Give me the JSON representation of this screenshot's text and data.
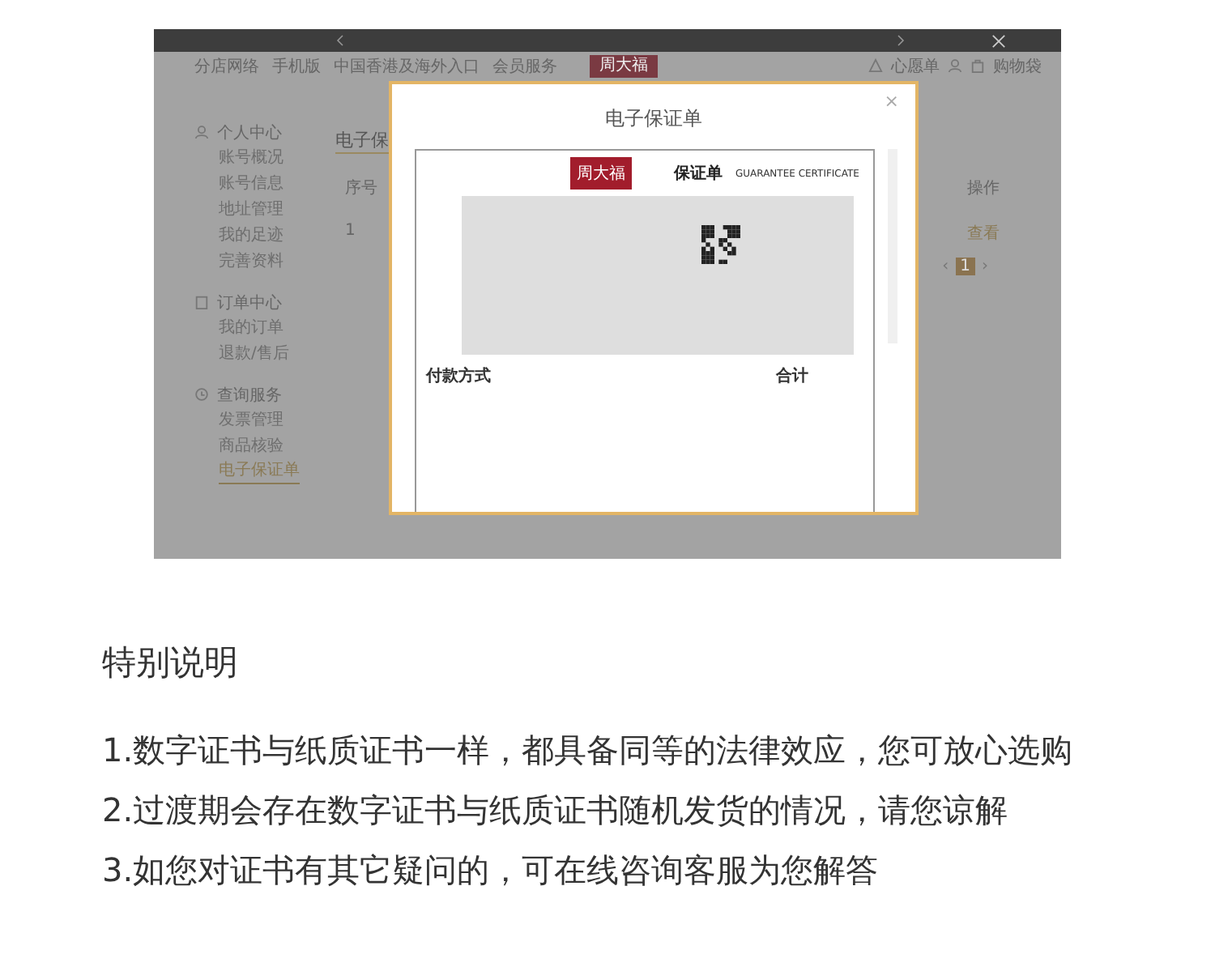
{
  "header": {
    "nav": [
      "分店网络",
      "手机版",
      "中国香港及海外入口",
      "会员服务"
    ],
    "logo": "周大福",
    "actions": [
      {
        "label": "心愿单"
      },
      {
        "label": "购物袋"
      }
    ]
  },
  "sidebar": {
    "groups": [
      {
        "title": "个人中心",
        "items": [
          {
            "label": "账号概况",
            "selected": false
          },
          {
            "label": "账号信息",
            "selected": false
          },
          {
            "label": "地址管理",
            "selected": false
          },
          {
            "label": "我的足迹",
            "selected": false
          },
          {
            "label": "完善资料",
            "selected": false
          }
        ]
      },
      {
        "title": "订单中心",
        "items": [
          {
            "label": "我的订单",
            "selected": false
          },
          {
            "label": "退款/售后",
            "selected": false
          }
        ]
      },
      {
        "title": "查询服务",
        "items": [
          {
            "label": "发票管理",
            "selected": false
          },
          {
            "label": "商品核验",
            "selected": false
          },
          {
            "label": "电子保证单",
            "selected": true
          }
        ]
      }
    ]
  },
  "main": {
    "title": "电子保",
    "columns": [
      "序号",
      "操作"
    ],
    "rows": [
      {
        "index": "1",
        "action": "查看"
      }
    ],
    "pagination": {
      "prev": "‹",
      "next": "›",
      "pages": [
        {
          "label": "1",
          "selected": true
        }
      ]
    }
  },
  "modal": {
    "title": "电子保证单",
    "close": "×",
    "certificate": {
      "logo": "周大福",
      "title": "保证单",
      "subtitle": "GUARANTEE CERTIFICATE",
      "payment_label": "付款方式",
      "total_label": "合计"
    }
  },
  "notes": {
    "title": "特别说明",
    "items": [
      "1.数字证书与纸质证书一样，都具备同等的法律效应，您可放心选购",
      "2.过渡期会存在数字证书与纸质证书随机发货的情况，请您谅解",
      "3.如您对证书有其它疑问的，可在线咨询客服为您解答"
    ]
  }
}
